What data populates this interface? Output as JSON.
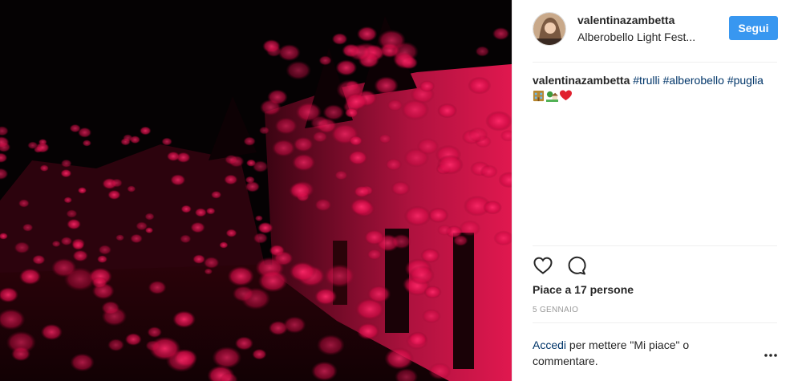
{
  "post": {
    "username": "valentinazambetta",
    "location": "Alberobello Light Fest...",
    "follow_label": "Segui"
  },
  "caption": {
    "username": "valentinazambetta",
    "hashtags": [
      "#trulli",
      "#alberobello",
      "#puglia"
    ],
    "emojis": [
      "house-buildings-emoji",
      "house-with-garden-emoji",
      "red-heart-emoji"
    ]
  },
  "actions": {
    "like_icon": "heart-outline-icon",
    "comment_icon": "comment-bubble-icon"
  },
  "likes_text": "Piace a 17 persone",
  "date_text": "5 GENNAIO",
  "login_prompt": {
    "link": "Accedi",
    "rest": "per mettere \"Mi piace\" o commentare."
  },
  "more_icon": "more-options-icon",
  "colors": {
    "accent": "#3897f0",
    "hashtag": "#003569",
    "light_pink": "#ff1e5a",
    "background": "#ffffff"
  }
}
